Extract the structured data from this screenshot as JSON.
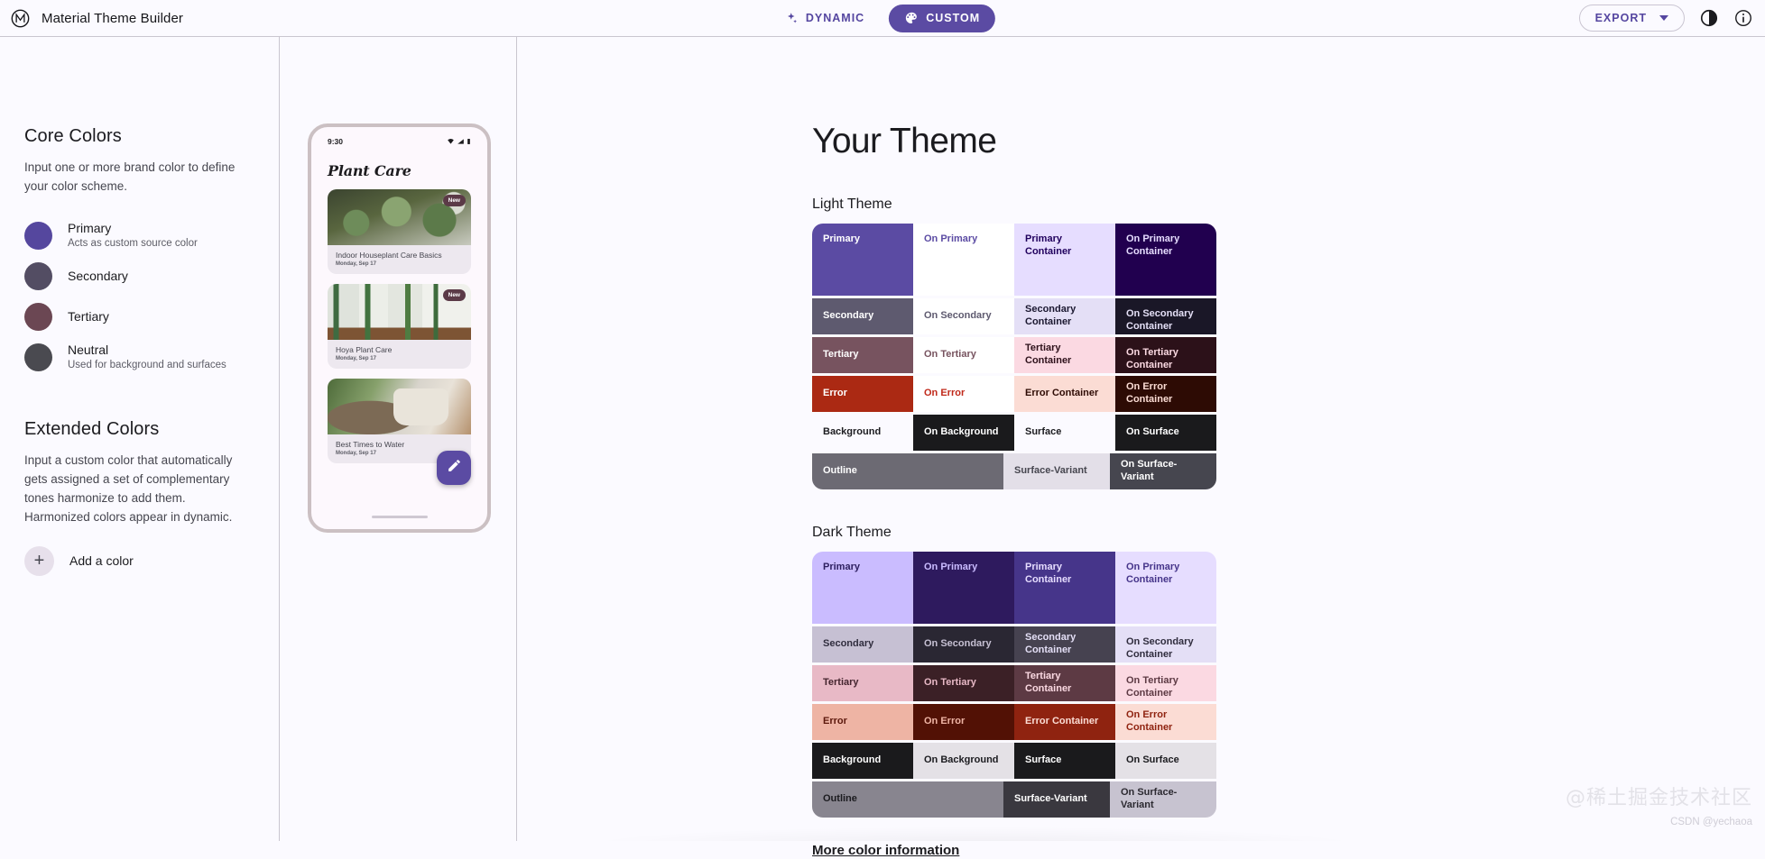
{
  "appbar": {
    "brand_title": "Material Theme Builder",
    "logo_icon": "material-logo-icon",
    "dynamic_label": "DYNAMIC",
    "dynamic_icon": "sparkle-icon",
    "custom_label": "CUSTOM",
    "custom_icon": "palette-icon",
    "export_label": "EXPORT",
    "export_caret_icon": "chevron-down-icon",
    "brightness_icon": "brightness-contrast-icon",
    "info_icon": "info-circle-icon",
    "accent": "#5546a0",
    "active_pill": "#5b4ba3"
  },
  "core_colors": {
    "title": "Core Colors",
    "description": "Input one or more brand color to define your color scheme.",
    "items": [
      {
        "name": "Primary",
        "sub": "Acts as custom source color",
        "color": "#55479e"
      },
      {
        "name": "Secondary",
        "sub": "",
        "color": "#534d63"
      },
      {
        "name": "Tertiary",
        "sub": "",
        "color": "#6b4753"
      },
      {
        "name": "Neutral",
        "sub": "Used for background and surfaces",
        "color": "#4a4a50"
      }
    ]
  },
  "extended_colors": {
    "title": "Extended Colors",
    "description": "Input a custom color that automatically gets assigned a set of complementary tones harmonize to add them. Harmonized colors appear in dynamic.",
    "add_label": "Add a color",
    "add_icon": "plus-icon"
  },
  "phone": {
    "status_time": "9:30",
    "status_icons": [
      "wifi-icon",
      "signal-icon",
      "battery-icon"
    ],
    "app_title": "Plant Care",
    "badge_label": "New",
    "fab_icon": "pencil-icon",
    "cards": [
      {
        "title": "Indoor Houseplant Care Basics",
        "date": "Monday, Sep 17",
        "badge": "New"
      },
      {
        "title": "Hoya Plant Care",
        "date": "Monday, Sep 17",
        "badge": "New"
      },
      {
        "title": "Best Times to Water",
        "date": "Monday, Sep 17",
        "badge": ""
      }
    ]
  },
  "theme": {
    "title": "Your Theme",
    "light_label": "Light Theme",
    "dark_label": "Dark Theme",
    "more_link": "More color information",
    "light_rows": [
      {
        "tall": true,
        "cells": [
          {
            "label": "Primary",
            "bg": "#5b4ba3",
            "fg": "#ffffff"
          },
          {
            "label": "On Primary",
            "bg": "#ffffff",
            "fg": "#5b4ba3"
          },
          {
            "label": "Primary Container",
            "bg": "#e6ddff",
            "fg": "#20005d"
          },
          {
            "label": "On Primary Container",
            "bg": "#21004f",
            "fg": "#e6ddff"
          }
        ]
      },
      {
        "tall": false,
        "cells": [
          {
            "label": "Secondary",
            "bg": "#5e5a6f",
            "fg": "#ffffff"
          },
          {
            "label": "On Secondary",
            "bg": "#ffffff",
            "fg": "#5e5a6f"
          },
          {
            "label": "Secondary Container",
            "bg": "#e4dff6",
            "fg": "#1b1830"
          },
          {
            "label": "On Secondary Container",
            "bg": "#1a1727",
            "fg": "#e4dff6"
          }
        ]
      },
      {
        "tall": false,
        "cells": [
          {
            "label": "Tertiary",
            "bg": "#77535f",
            "fg": "#ffffff"
          },
          {
            "label": "On Tertiary",
            "bg": "#ffffff",
            "fg": "#77535f"
          },
          {
            "label": "Tertiary Container",
            "bg": "#fbd9e2",
            "fg": "#2e111b"
          },
          {
            "label": "On Tertiary Container",
            "bg": "#2c1119",
            "fg": "#fbd9e2"
          }
        ]
      },
      {
        "tall": false,
        "cells": [
          {
            "label": "Error",
            "bg": "#ab2913",
            "fg": "#ffffff"
          },
          {
            "label": "On Error",
            "bg": "#ffffff",
            "fg": "#c0291a"
          },
          {
            "label": "Error Container",
            "bg": "#fbdcd4",
            "fg": "#2e0b04"
          },
          {
            "label": "On Error Container",
            "bg": "#2d0b04",
            "fg": "#fbdcd4"
          }
        ]
      },
      {
        "tall": false,
        "cells": [
          {
            "label": "Background",
            "bg": "#fbfaff",
            "fg": "#1b1b1f"
          },
          {
            "label": "On Background",
            "bg": "#1a1a1c",
            "fg": "#ffffff"
          },
          {
            "label": "Surface",
            "bg": "#fbfaff",
            "fg": "#1b1b1f"
          },
          {
            "label": "On Surface",
            "bg": "#1a1a1c",
            "fg": "#ffffff"
          }
        ]
      },
      {
        "tall": false,
        "cells": [
          {
            "label": "Outline",
            "bg": "#6c6a73",
            "fg": "#ffffff",
            "span": 2
          },
          {
            "label": "Surface-Variant",
            "bg": "#e3dfe8",
            "fg": "#46464f"
          },
          {
            "label": "On Surface-Variant",
            "bg": "#46464f",
            "fg": "#ffffff"
          }
        ]
      }
    ],
    "dark_rows": [
      {
        "tall": true,
        "cells": [
          {
            "label": "Primary",
            "bg": "#cabcff",
            "fg": "#2e2060"
          },
          {
            "label": "On Primary",
            "bg": "#2e1a5e",
            "fg": "#cabcff"
          },
          {
            "label": "Primary Container",
            "bg": "#46358a",
            "fg": "#e6ddff"
          },
          {
            "label": "On Primary Container",
            "bg": "#e6ddff",
            "fg": "#46358a"
          }
        ]
      },
      {
        "tall": false,
        "cells": [
          {
            "label": "Secondary",
            "bg": "#c6c0d3",
            "fg": "#302d3e"
          },
          {
            "label": "On Secondary",
            "bg": "#2a2733",
            "fg": "#c6c0d3"
          },
          {
            "label": "Secondary Container",
            "bg": "#464250",
            "fg": "#e4dff6"
          },
          {
            "label": "On Secondary Container",
            "bg": "#e4dff6",
            "fg": "#302d3e"
          }
        ]
      },
      {
        "tall": false,
        "cells": [
          {
            "label": "Tertiary",
            "bg": "#e8b9c6",
            "fg": "#44252f"
          },
          {
            "label": "On Tertiary",
            "bg": "#3b2026",
            "fg": "#e8b9c6"
          },
          {
            "label": "Tertiary Container",
            "bg": "#5d3a44",
            "fg": "#fbd9e2"
          },
          {
            "label": "On Tertiary Container",
            "bg": "#fbd9e2",
            "fg": "#5d3a44"
          }
        ]
      },
      {
        "tall": false,
        "cells": [
          {
            "label": "Error",
            "bg": "#eeb4a4",
            "fg": "#5c180c"
          },
          {
            "label": "On Error",
            "bg": "#521105",
            "fg": "#eeb4a4"
          },
          {
            "label": "Error Container",
            "bg": "#8f2310",
            "fg": "#fbdcd4"
          },
          {
            "label": "On Error Container",
            "bg": "#fbdcd4",
            "fg": "#8f2310"
          }
        ]
      },
      {
        "tall": false,
        "cells": [
          {
            "label": "Background",
            "bg": "#1a1a1c",
            "fg": "#ffffff"
          },
          {
            "label": "On Background",
            "bg": "#e4e1e6",
            "fg": "#1b1b1f"
          },
          {
            "label": "Surface",
            "bg": "#1a1a1c",
            "fg": "#ffffff"
          },
          {
            "label": "On Surface",
            "bg": "#e4e1e6",
            "fg": "#1b1b1f"
          }
        ]
      },
      {
        "tall": false,
        "cells": [
          {
            "label": "Outline",
            "bg": "#88858f",
            "fg": "#1b1b1f",
            "span": 2
          },
          {
            "label": "Surface-Variant",
            "bg": "#3a383f",
            "fg": "#ffffff"
          },
          {
            "label": "On Surface-Variant",
            "bg": "#c7c3d0",
            "fg": "#2b2930"
          }
        ]
      }
    ]
  },
  "watermarks": {
    "cn": "@稀土掘金技术社区",
    "csdn": "CSDN @yechaoa"
  }
}
